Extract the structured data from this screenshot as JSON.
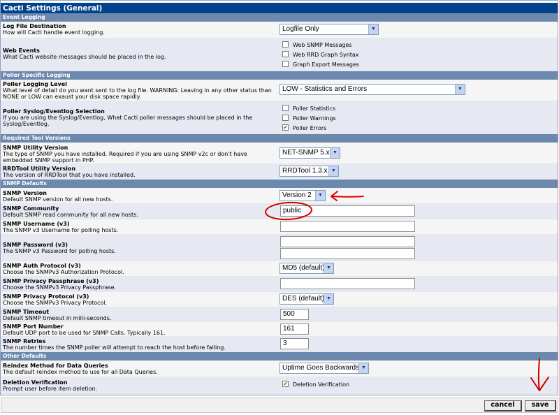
{
  "title": "Cacti Settings (General)",
  "sections": {
    "event_logging": "Event Logging",
    "poller_logging": "Poller Specific Logging",
    "required_tools": "Required Tool Versions",
    "snmp_defaults": "SNMP Defaults",
    "other_defaults": "Other Defaults"
  },
  "log_destination": {
    "label": "Log File Destination",
    "desc": "How will Cacti handle event logging.",
    "value": "Logfile Only"
  },
  "web_events": {
    "label": "Web Events",
    "desc": "What Cacti website messages should be placed in the log.",
    "options": [
      {
        "label": "Web SNMP Messages",
        "checked": false
      },
      {
        "label": "Web RRD Graph Syntax",
        "checked": false
      },
      {
        "label": "Graph Export Messages",
        "checked": false
      }
    ]
  },
  "poller_level": {
    "label": "Poller Logging Level",
    "desc1": "What level of detail do you want sent to the log file. WARNING: Leaving in any other status than",
    "desc2": "NONE or LOW can exaust your disk space rapidly.",
    "value": "LOW - Statistics and Errors"
  },
  "poller_syslog": {
    "label": "Poller Syslog/Eventlog Selection",
    "desc1": "If you are using the Syslog/Eventlog, What Cacti poller messages should be placed in the",
    "desc2": "Syslog/Eventlog.",
    "options": [
      {
        "label": "Poller Statistics",
        "checked": false
      },
      {
        "label": "Poller Warnings",
        "checked": false
      },
      {
        "label": "Poller Errors",
        "checked": true
      }
    ]
  },
  "snmp_utility": {
    "label": "SNMP Utility Version",
    "desc1": "The type of SNMP you have installed. Required if you are using SNMP v2c or don't have",
    "desc2": "embedded SNMP support in PHP.",
    "value": "NET-SNMP 5.x"
  },
  "rrdtool": {
    "label": "RRDTool Utility Version",
    "desc": "The version of RRDTool that you have installed.",
    "value": "RRDTool 1.3.x"
  },
  "snmp_version": {
    "label": "SNMP Version",
    "desc": "Default SNMP version for all new hosts.",
    "value": "Version 2"
  },
  "snmp_community": {
    "label": "SNMP Community",
    "desc": "Default SNMP read community for all new hosts.",
    "value": "public"
  },
  "snmp_username": {
    "label": "SNMP Username (v3)",
    "desc": "The SNMP v3 Username for polling hosts.",
    "value": ""
  },
  "snmp_password": {
    "label": "SNMP Password (v3)",
    "desc": "The SNMP v3 Password for polling hosts.",
    "value": "",
    "confirm": ""
  },
  "snmp_auth": {
    "label": "SNMP Auth Protocol (v3)",
    "desc": "Choose the SNMPv3 Authorization Protocol.",
    "value": "MD5 (default)"
  },
  "snmp_privpass": {
    "label": "SNMP Privacy Passphrase (v3)",
    "desc": "Choose the SNMPv3 Privacy Passphrase.",
    "value": ""
  },
  "snmp_privproto": {
    "label": "SNMP Privacy Protocol (v3)",
    "desc": "Choose the SNMPv3 Privacy Protocol.",
    "value": "DES (default)"
  },
  "snmp_timeout": {
    "label": "SNMP Timeout",
    "desc": "Default SNMP timeout in milli-seconds.",
    "value": "500"
  },
  "snmp_port": {
    "label": "SNMP Port Number",
    "desc": "Default UDP port to be used for SNMP Calls. Typically 161.",
    "value": "161"
  },
  "snmp_retries": {
    "label": "SNMP Retries",
    "desc": "The number times the SNMP poller will attempt to reach the host before failing.",
    "value": "3"
  },
  "reindex": {
    "label": "Reindex Method for Data Queries",
    "desc": "The default reindex method to use for all Data Queries.",
    "value": "Uptime Goes Backwards"
  },
  "deletion": {
    "label": "Deletion Verification",
    "desc": "Prompt user before item deletion.",
    "option": "Deletion Verification",
    "checked": true
  },
  "buttons": {
    "cancel": "cancel",
    "save": "save"
  },
  "annotation_color": "#d40000"
}
